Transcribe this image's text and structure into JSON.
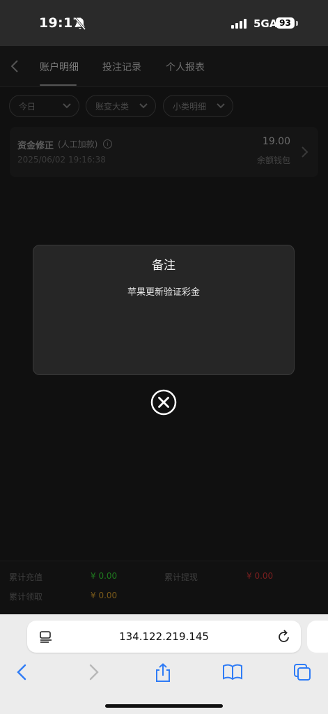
{
  "status_bar": {
    "time": "19:17",
    "network": "5GA",
    "battery": "93"
  },
  "nav": {
    "tabs": [
      {
        "label": "账户明细",
        "active": true
      },
      {
        "label": "投注记录",
        "active": false
      },
      {
        "label": "个人报表",
        "active": false
      }
    ]
  },
  "filters": {
    "date": "今日",
    "category": "账变大类",
    "subcategory": "小类明细"
  },
  "record": {
    "title": "资金修正",
    "subtitle": "(人工加款)",
    "datetime": "2025/06/02 19:16:38",
    "amount": "19.00",
    "wallet": "余额钱包"
  },
  "summary": {
    "recharge_label": "累计充值",
    "recharge_value": "¥ 0.00",
    "recharge_color": "#1f7a1f",
    "withdraw_label": "累计提现",
    "withdraw_value": "¥ 0.00",
    "withdraw_color": "#7a1f1f",
    "claim_label": "累计领取",
    "claim_value": "¥ 0.00",
    "claim_color": "#7a5a1a"
  },
  "modal": {
    "title": "备注",
    "body": "苹果更新验证彩金"
  },
  "browser": {
    "url": "134.122.219.145",
    "accent": "#2f7cf6"
  }
}
